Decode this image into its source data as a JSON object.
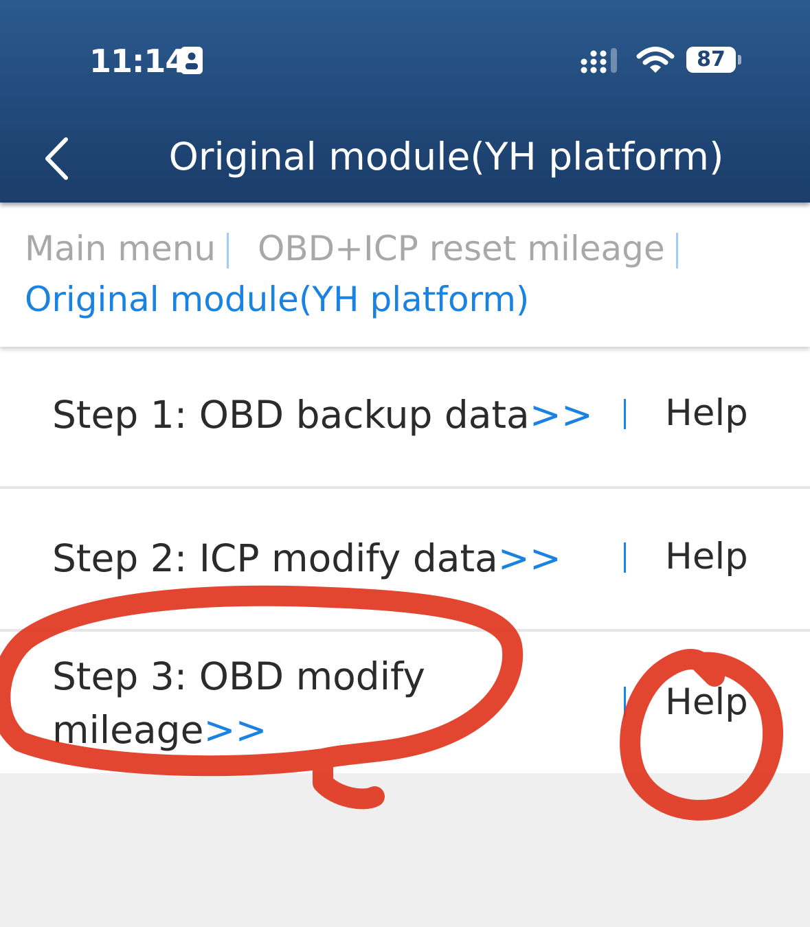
{
  "status_bar": {
    "time": "11:14",
    "battery": "87",
    "icons": [
      "id-card-icon",
      "signal-icon",
      "wifi-icon",
      "battery-icon"
    ]
  },
  "nav": {
    "title": "Original module(YH platform)",
    "back_icon": "chevron-left-icon"
  },
  "breadcrumb": {
    "items": [
      "Main menu",
      "OBD+ICP reset mileage",
      "Original module(YH platform)"
    ]
  },
  "steps": [
    {
      "label": "Step 1: OBD backup data",
      "arrows": ">>",
      "help": "Help"
    },
    {
      "label": "Step 2: ICP modify data",
      "arrows": ">>",
      "help": "Help"
    },
    {
      "label_line1": "Step 3: OBD modify",
      "label_line2": "mileage",
      "arrows": ">>",
      "help": "Help"
    }
  ],
  "colors": {
    "header": "#21497a",
    "accent": "#1a82e0",
    "annotation": "#e0361e"
  }
}
